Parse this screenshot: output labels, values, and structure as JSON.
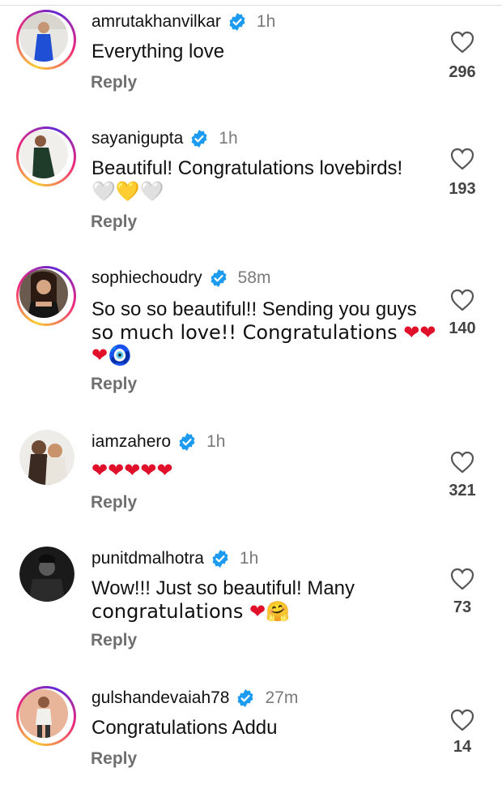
{
  "comments": [
    {
      "username": "amrutakhanvilkar",
      "time": "1h",
      "text_lines": [
        "Everything love"
      ],
      "likes": "296",
      "reply_label": "Reply",
      "avatar": "woman-in-blue-dress"
    },
    {
      "username": "sayanigupta",
      "time": "1h",
      "text_lines": [
        "Beautiful! Congratulations lovebirds!",
        "🤍💛🤍"
      ],
      "likes": "193",
      "reply_label": "Reply",
      "avatar": "person-in-green-outfit"
    },
    {
      "username": "sophiechoudry",
      "time": "58m",
      "text_lines": [
        "So so so beautiful!! Sending you guys",
        "so much love!! Congratulations ❤️❤️",
        "❤️🧿"
      ],
      "likes": "140",
      "reply_label": "Reply",
      "avatar": "woman-portrait"
    },
    {
      "username": "iamzahero",
      "time": "1h",
      "text_lines": [
        "❤️❤️❤️❤️❤️"
      ],
      "likes": "321",
      "reply_label": "Reply",
      "avatar": "couple-photo"
    },
    {
      "username": "punitdmalhotra",
      "time": "1h",
      "text_lines": [
        "Wow!!! Just so beautiful! Many",
        "congratulations ❤️🤗"
      ],
      "likes": "73",
      "reply_label": "Reply",
      "avatar": "man-monochrome"
    },
    {
      "username": "gulshandevaiah78",
      "time": "27m",
      "text_lines": [
        "Congratulations Addu"
      ],
      "likes": "14",
      "reply_label": "Reply",
      "avatar": "man-standing"
    }
  ],
  "colors": {
    "verified": "#1d9bf0",
    "heart_emoji": "#e0102a",
    "muted_text": "#6f6f6f"
  },
  "icons": {
    "verified": "verified-badge-icon",
    "like": "heart-outline-icon"
  }
}
